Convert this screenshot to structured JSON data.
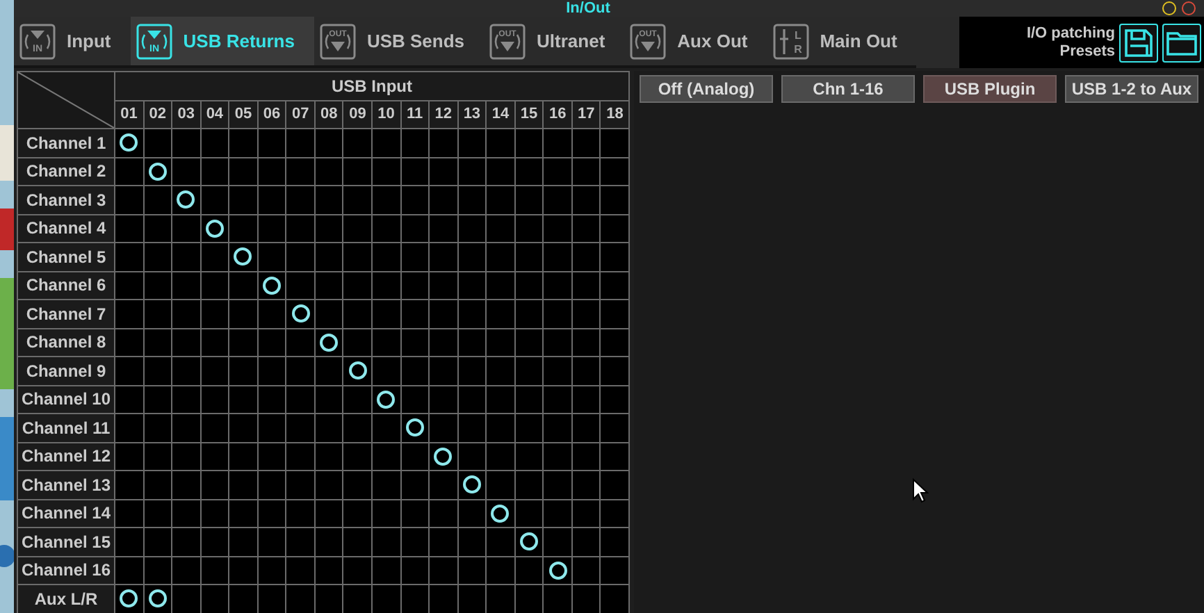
{
  "window": {
    "title": "In/Out"
  },
  "tabs": [
    {
      "label": "Input",
      "kind": "in",
      "icon_labels": [
        "IN"
      ],
      "selected": false
    },
    {
      "label": "USB Returns",
      "kind": "in",
      "icon_labels": [
        "IN"
      ],
      "selected": true
    },
    {
      "label": "USB Sends",
      "kind": "out",
      "icon_labels": [
        "OUT"
      ],
      "selected": false
    },
    {
      "label": "Ultranet",
      "kind": "out",
      "icon_labels": [
        "OUT"
      ],
      "selected": false
    },
    {
      "label": "Aux Out",
      "kind": "out",
      "icon_labels": [
        "OUT"
      ],
      "selected": false
    },
    {
      "label": "Main Out",
      "kind": "lr",
      "icon_labels": [
        "L",
        "R"
      ],
      "selected": false
    }
  ],
  "presets": {
    "label_lines": [
      "I/O patching",
      "Presets"
    ]
  },
  "matrix": {
    "title": "USB Input",
    "columns": [
      "01",
      "02",
      "03",
      "04",
      "05",
      "06",
      "07",
      "08",
      "09",
      "10",
      "11",
      "12",
      "13",
      "14",
      "15",
      "16",
      "17",
      "18"
    ],
    "rows": [
      {
        "label": "Channel 1",
        "connected": [
          true,
          false,
          false,
          false,
          false,
          false,
          false,
          false,
          false,
          false,
          false,
          false,
          false,
          false,
          false,
          false,
          false,
          false
        ]
      },
      {
        "label": "Channel 2",
        "connected": [
          false,
          true,
          false,
          false,
          false,
          false,
          false,
          false,
          false,
          false,
          false,
          false,
          false,
          false,
          false,
          false,
          false,
          false
        ]
      },
      {
        "label": "Channel 3",
        "connected": [
          false,
          false,
          true,
          false,
          false,
          false,
          false,
          false,
          false,
          false,
          false,
          false,
          false,
          false,
          false,
          false,
          false,
          false
        ]
      },
      {
        "label": "Channel 4",
        "connected": [
          false,
          false,
          false,
          true,
          false,
          false,
          false,
          false,
          false,
          false,
          false,
          false,
          false,
          false,
          false,
          false,
          false,
          false
        ]
      },
      {
        "label": "Channel 5",
        "connected": [
          false,
          false,
          false,
          false,
          true,
          false,
          false,
          false,
          false,
          false,
          false,
          false,
          false,
          false,
          false,
          false,
          false,
          false
        ]
      },
      {
        "label": "Channel 6",
        "connected": [
          false,
          false,
          false,
          false,
          false,
          true,
          false,
          false,
          false,
          false,
          false,
          false,
          false,
          false,
          false,
          false,
          false,
          false
        ]
      },
      {
        "label": "Channel 7",
        "connected": [
          false,
          false,
          false,
          false,
          false,
          false,
          true,
          false,
          false,
          false,
          false,
          false,
          false,
          false,
          false,
          false,
          false,
          false
        ]
      },
      {
        "label": "Channel 8",
        "connected": [
          false,
          false,
          false,
          false,
          false,
          false,
          false,
          true,
          false,
          false,
          false,
          false,
          false,
          false,
          false,
          false,
          false,
          false
        ]
      },
      {
        "label": "Channel 9",
        "connected": [
          false,
          false,
          false,
          false,
          false,
          false,
          false,
          false,
          true,
          false,
          false,
          false,
          false,
          false,
          false,
          false,
          false,
          false
        ]
      },
      {
        "label": "Channel 10",
        "connected": [
          false,
          false,
          false,
          false,
          false,
          false,
          false,
          false,
          false,
          true,
          false,
          false,
          false,
          false,
          false,
          false,
          false,
          false
        ]
      },
      {
        "label": "Channel 11",
        "connected": [
          false,
          false,
          false,
          false,
          false,
          false,
          false,
          false,
          false,
          false,
          true,
          false,
          false,
          false,
          false,
          false,
          false,
          false
        ]
      },
      {
        "label": "Channel 12",
        "connected": [
          false,
          false,
          false,
          false,
          false,
          false,
          false,
          false,
          false,
          false,
          false,
          true,
          false,
          false,
          false,
          false,
          false,
          false
        ]
      },
      {
        "label": "Channel 13",
        "connected": [
          false,
          false,
          false,
          false,
          false,
          false,
          false,
          false,
          false,
          false,
          false,
          false,
          true,
          false,
          false,
          false,
          false,
          false
        ]
      },
      {
        "label": "Channel 14",
        "connected": [
          false,
          false,
          false,
          false,
          false,
          false,
          false,
          false,
          false,
          false,
          false,
          false,
          false,
          true,
          false,
          false,
          false,
          false
        ]
      },
      {
        "label": "Channel 15",
        "connected": [
          false,
          false,
          false,
          false,
          false,
          false,
          false,
          false,
          false,
          false,
          false,
          false,
          false,
          false,
          true,
          false,
          false,
          false
        ]
      },
      {
        "label": "Channel 16",
        "connected": [
          false,
          false,
          false,
          false,
          false,
          false,
          false,
          false,
          false,
          false,
          false,
          false,
          false,
          false,
          false,
          true,
          false,
          false
        ]
      },
      {
        "label": "Aux L/R",
        "connected": [
          true,
          true,
          false,
          false,
          false,
          false,
          false,
          false,
          false,
          false,
          false,
          false,
          false,
          false,
          false,
          false,
          false,
          false
        ]
      }
    ]
  },
  "routing_buttons": [
    {
      "label": "Off (Analog)",
      "selected": false
    },
    {
      "label": "Chn 1-16",
      "selected": false
    },
    {
      "label": "USB Plugin",
      "selected": true
    },
    {
      "label": "USB 1-2 to Aux",
      "selected": false
    }
  ]
}
